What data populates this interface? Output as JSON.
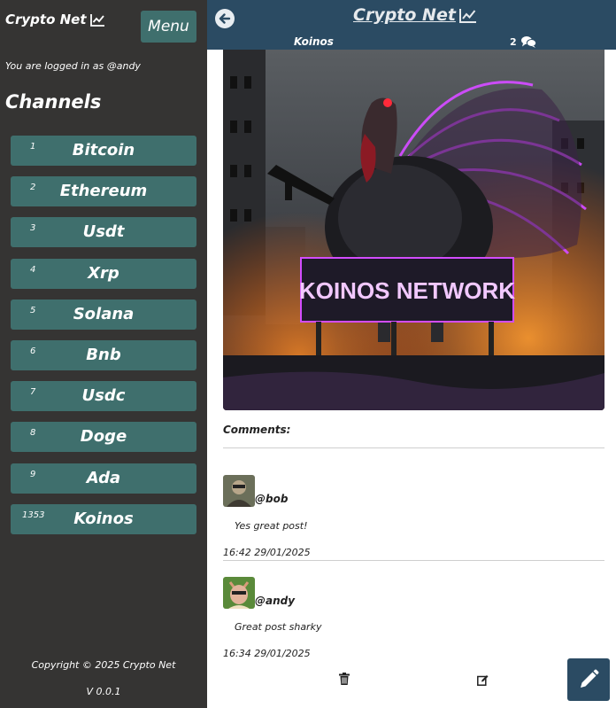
{
  "app": {
    "brand": "Crypto Net"
  },
  "sidebar": {
    "menu_label": "Menu",
    "logged_in_text": "You are logged in as @andy",
    "channels_title": "Channels",
    "channels": [
      {
        "num": "1",
        "name": "Bitcoin"
      },
      {
        "num": "2",
        "name": "Ethereum"
      },
      {
        "num": "3",
        "name": "Usdt"
      },
      {
        "num": "4",
        "name": "Xrp"
      },
      {
        "num": "5",
        "name": "Solana"
      },
      {
        "num": "6",
        "name": "Bnb"
      },
      {
        "num": "7",
        "name": "Usdc"
      },
      {
        "num": "8",
        "name": "Doge"
      },
      {
        "num": "9",
        "name": "Ada"
      },
      {
        "num": "1353",
        "name": "Koinos"
      }
    ],
    "copyright": "Copyright © 2025 Crypto Net",
    "version": "V 0.0.1"
  },
  "header": {
    "title": "Crypto Net",
    "channel": "Koinos",
    "comment_count": "2"
  },
  "post": {
    "image_banner_text": "KOINOS NETWORK"
  },
  "comments": {
    "label": "Comments:",
    "items": [
      {
        "user": "@bob",
        "text": "Yes great post!",
        "time": "16:42 29/01/2025"
      },
      {
        "user": "@andy",
        "text": "Great post sharky",
        "time": "16:34 29/01/2025"
      }
    ]
  },
  "colors": {
    "sidebar_bg": "#353433",
    "channel_bg": "#3f6f6d",
    "header_bg": "#2b4b63",
    "neon": "#d24cff"
  },
  "icons": [
    "chart-line-icon",
    "arrow-left-icon",
    "comments-icon",
    "trash-icon",
    "edit-icon",
    "pencil-icon"
  ]
}
